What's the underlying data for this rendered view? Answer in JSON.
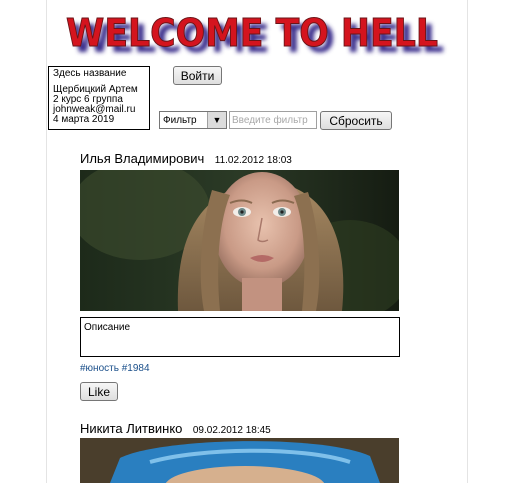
{
  "header": {
    "logo_text": "WELCOME TO HELL"
  },
  "info": {
    "title": "Здесь название",
    "author": "Щербицкий Артем",
    "group": "2 курс 6 группа",
    "email": "johnweak@mail.ru",
    "date": "4 марта 2019"
  },
  "toolbar": {
    "login_label": "Войти",
    "filter_select_value": "Фильтр",
    "filter_placeholder": "Введите фильтр",
    "reset_label": "Сбросить"
  },
  "posts": [
    {
      "author": "Илья Владимирович",
      "datetime": "11.02.2012 18:03",
      "description": "Описание",
      "hashtags": "#юность #1984",
      "like_label": "Like"
    },
    {
      "author": "Никита Литвинко",
      "datetime": "09.02.2012 18:45"
    }
  ],
  "colors": {
    "logo_red": "#d4141e",
    "logo_shadow": "#3a2d8c",
    "hashtag_blue": "#1a4f8a"
  }
}
